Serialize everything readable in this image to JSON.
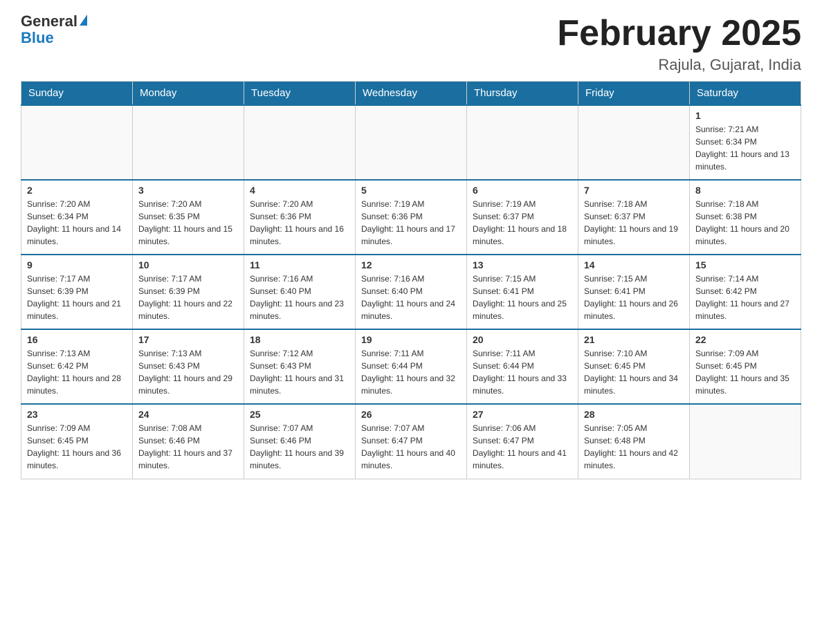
{
  "header": {
    "logo_general": "General",
    "logo_blue": "Blue",
    "title": "February 2025",
    "subtitle": "Rajula, Gujarat, India"
  },
  "days_of_week": [
    "Sunday",
    "Monday",
    "Tuesday",
    "Wednesday",
    "Thursday",
    "Friday",
    "Saturday"
  ],
  "weeks": [
    [
      {
        "day": "",
        "info": ""
      },
      {
        "day": "",
        "info": ""
      },
      {
        "day": "",
        "info": ""
      },
      {
        "day": "",
        "info": ""
      },
      {
        "day": "",
        "info": ""
      },
      {
        "day": "",
        "info": ""
      },
      {
        "day": "1",
        "info": "Sunrise: 7:21 AM\nSunset: 6:34 PM\nDaylight: 11 hours and 13 minutes."
      }
    ],
    [
      {
        "day": "2",
        "info": "Sunrise: 7:20 AM\nSunset: 6:34 PM\nDaylight: 11 hours and 14 minutes."
      },
      {
        "day": "3",
        "info": "Sunrise: 7:20 AM\nSunset: 6:35 PM\nDaylight: 11 hours and 15 minutes."
      },
      {
        "day": "4",
        "info": "Sunrise: 7:20 AM\nSunset: 6:36 PM\nDaylight: 11 hours and 16 minutes."
      },
      {
        "day": "5",
        "info": "Sunrise: 7:19 AM\nSunset: 6:36 PM\nDaylight: 11 hours and 17 minutes."
      },
      {
        "day": "6",
        "info": "Sunrise: 7:19 AM\nSunset: 6:37 PM\nDaylight: 11 hours and 18 minutes."
      },
      {
        "day": "7",
        "info": "Sunrise: 7:18 AM\nSunset: 6:37 PM\nDaylight: 11 hours and 19 minutes."
      },
      {
        "day": "8",
        "info": "Sunrise: 7:18 AM\nSunset: 6:38 PM\nDaylight: 11 hours and 20 minutes."
      }
    ],
    [
      {
        "day": "9",
        "info": "Sunrise: 7:17 AM\nSunset: 6:39 PM\nDaylight: 11 hours and 21 minutes."
      },
      {
        "day": "10",
        "info": "Sunrise: 7:17 AM\nSunset: 6:39 PM\nDaylight: 11 hours and 22 minutes."
      },
      {
        "day": "11",
        "info": "Sunrise: 7:16 AM\nSunset: 6:40 PM\nDaylight: 11 hours and 23 minutes."
      },
      {
        "day": "12",
        "info": "Sunrise: 7:16 AM\nSunset: 6:40 PM\nDaylight: 11 hours and 24 minutes."
      },
      {
        "day": "13",
        "info": "Sunrise: 7:15 AM\nSunset: 6:41 PM\nDaylight: 11 hours and 25 minutes."
      },
      {
        "day": "14",
        "info": "Sunrise: 7:15 AM\nSunset: 6:41 PM\nDaylight: 11 hours and 26 minutes."
      },
      {
        "day": "15",
        "info": "Sunrise: 7:14 AM\nSunset: 6:42 PM\nDaylight: 11 hours and 27 minutes."
      }
    ],
    [
      {
        "day": "16",
        "info": "Sunrise: 7:13 AM\nSunset: 6:42 PM\nDaylight: 11 hours and 28 minutes."
      },
      {
        "day": "17",
        "info": "Sunrise: 7:13 AM\nSunset: 6:43 PM\nDaylight: 11 hours and 29 minutes."
      },
      {
        "day": "18",
        "info": "Sunrise: 7:12 AM\nSunset: 6:43 PM\nDaylight: 11 hours and 31 minutes."
      },
      {
        "day": "19",
        "info": "Sunrise: 7:11 AM\nSunset: 6:44 PM\nDaylight: 11 hours and 32 minutes."
      },
      {
        "day": "20",
        "info": "Sunrise: 7:11 AM\nSunset: 6:44 PM\nDaylight: 11 hours and 33 minutes."
      },
      {
        "day": "21",
        "info": "Sunrise: 7:10 AM\nSunset: 6:45 PM\nDaylight: 11 hours and 34 minutes."
      },
      {
        "day": "22",
        "info": "Sunrise: 7:09 AM\nSunset: 6:45 PM\nDaylight: 11 hours and 35 minutes."
      }
    ],
    [
      {
        "day": "23",
        "info": "Sunrise: 7:09 AM\nSunset: 6:45 PM\nDaylight: 11 hours and 36 minutes."
      },
      {
        "day": "24",
        "info": "Sunrise: 7:08 AM\nSunset: 6:46 PM\nDaylight: 11 hours and 37 minutes."
      },
      {
        "day": "25",
        "info": "Sunrise: 7:07 AM\nSunset: 6:46 PM\nDaylight: 11 hours and 39 minutes."
      },
      {
        "day": "26",
        "info": "Sunrise: 7:07 AM\nSunset: 6:47 PM\nDaylight: 11 hours and 40 minutes."
      },
      {
        "day": "27",
        "info": "Sunrise: 7:06 AM\nSunset: 6:47 PM\nDaylight: 11 hours and 41 minutes."
      },
      {
        "day": "28",
        "info": "Sunrise: 7:05 AM\nSunset: 6:48 PM\nDaylight: 11 hours and 42 minutes."
      },
      {
        "day": "",
        "info": ""
      }
    ]
  ]
}
